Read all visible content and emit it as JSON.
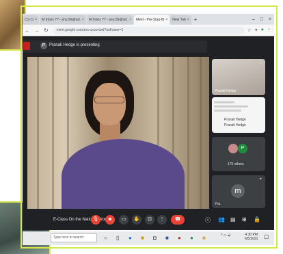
{
  "browser": {
    "tabs": [
      {
        "label": "CS Cl",
        "active": false
      },
      {
        "label": "M  Inbox ?? - anu.56@ssl.",
        "active": false
      },
      {
        "label": "M  Inbox ?? - anu.56@ssl.",
        "active": false
      },
      {
        "label": "Meet - Pre-Stap-Bl",
        "active": true
      },
      {
        "label": "New Tab",
        "active": false
      }
    ],
    "url": "meet.google.com/zsx-cscw-bxd?authuser=1",
    "window_controls": [
      "–",
      "□",
      "×"
    ]
  },
  "meet": {
    "presenting_text": "Pranali Hedge is presenting",
    "presenter_initial": "P",
    "tile1_name": "Pranali Hedge",
    "tile2_lines": [
      "Pranali Hedge",
      "Pranali Hedge"
    ],
    "tile3_avatar": "P",
    "tile3_count": "175 others",
    "tile4_initial": "m",
    "tile4_name": "You",
    "meeting_title": "E-Class On the National Wor...",
    "controls": {
      "mic": "mic-off",
      "cam": "cam-off"
    }
  },
  "taskbar": {
    "search_placeholder": "Type here to search",
    "clock_time": "4:30 PM",
    "clock_date": "6/5/2021"
  },
  "colors": {
    "frame": "#d7e64a",
    "meet_bg": "#202124",
    "end_call": "#ea4335"
  }
}
